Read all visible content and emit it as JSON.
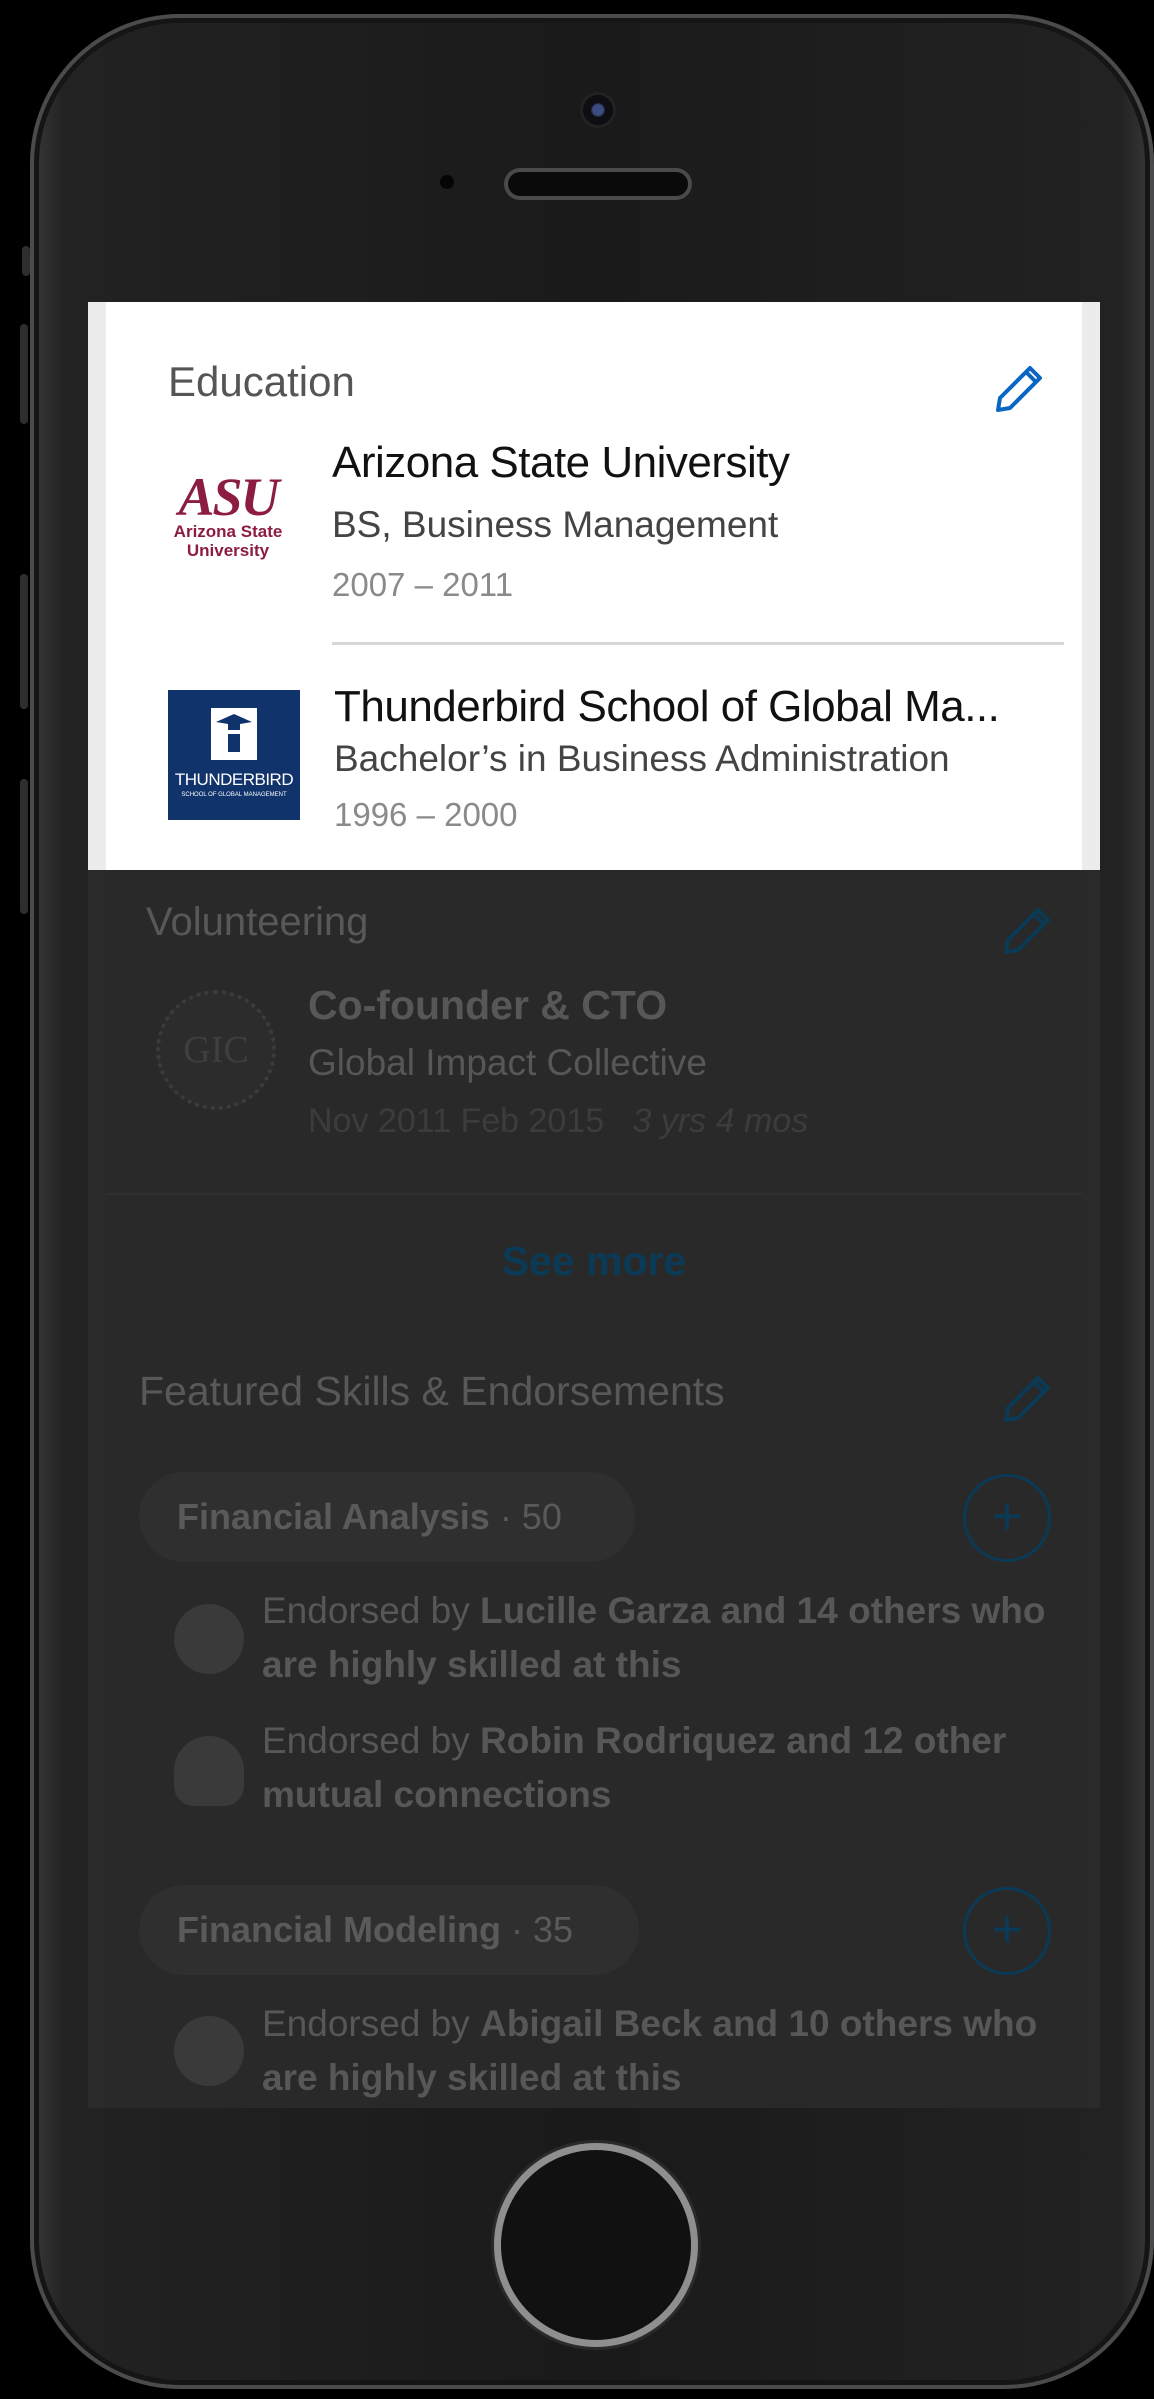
{
  "education": {
    "title": "Education",
    "items": [
      {
        "school": "Arizona State University",
        "degree": "BS, Business Management",
        "years": "2007 – 2011",
        "logo_text_main": "ASU",
        "logo_text_sub1": "Arizona State",
        "logo_text_sub2": "University"
      },
      {
        "school": "Thunderbird School of Global Ma...",
        "degree": "Bachelor’s in Business Administration",
        "years": "1996 – 2000",
        "logo_text_main": "THUNDERBIRD",
        "logo_text_sub1": "SCHOOL OF GLOBAL MANAGEMENT"
      }
    ]
  },
  "volunteering": {
    "title": "Volunteering",
    "role": "Co-founder & CTO",
    "org": "Global Impact Collective",
    "dates": "Nov 2011  Feb 2015",
    "duration": "3 yrs 4 mos",
    "logo_text": "GIC",
    "see_more": "See more"
  },
  "skills": {
    "title": "Featured Skills & Endorsements",
    "items": [
      {
        "name": "Financial Analysis",
        "count": "· 50",
        "endorsements": [
          {
            "prefix": "Endorsed by ",
            "bold1": "Lucille Garza and 14 others who",
            "line2": "are highly skilled at this"
          },
          {
            "prefix": "Endorsed by ",
            "bold1": "Robin Rodriquez and 12 other",
            "line2": "mutual connections"
          }
        ]
      },
      {
        "name": "Financial Modeling",
        "count": "· 35",
        "endorsements": [
          {
            "prefix": "Endorsed by ",
            "bold1": "Abigail Beck and 10 others who",
            "line2": "are highly skilled at this"
          }
        ]
      }
    ]
  },
  "colors": {
    "accent": "#0a66c2",
    "asu_maroon": "#8c1d40",
    "thunderbird_navy": "#10336b"
  }
}
